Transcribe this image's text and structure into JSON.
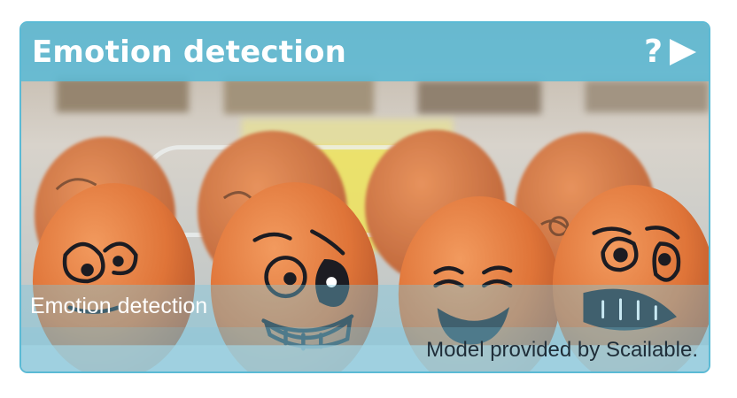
{
  "card": {
    "title": "Emotion detection",
    "help_symbol": "?",
    "play_icon": "play-icon",
    "caption": "Emotion detection",
    "credit": "Model provided by Scailable."
  },
  "colors": {
    "accent": "#5bbad5",
    "title_text": "#ffffff",
    "credit_text": "#1f2d38",
    "egg": "#e0793e",
    "egg_shadow": "#b9552a",
    "ink": "#1c1c22"
  }
}
